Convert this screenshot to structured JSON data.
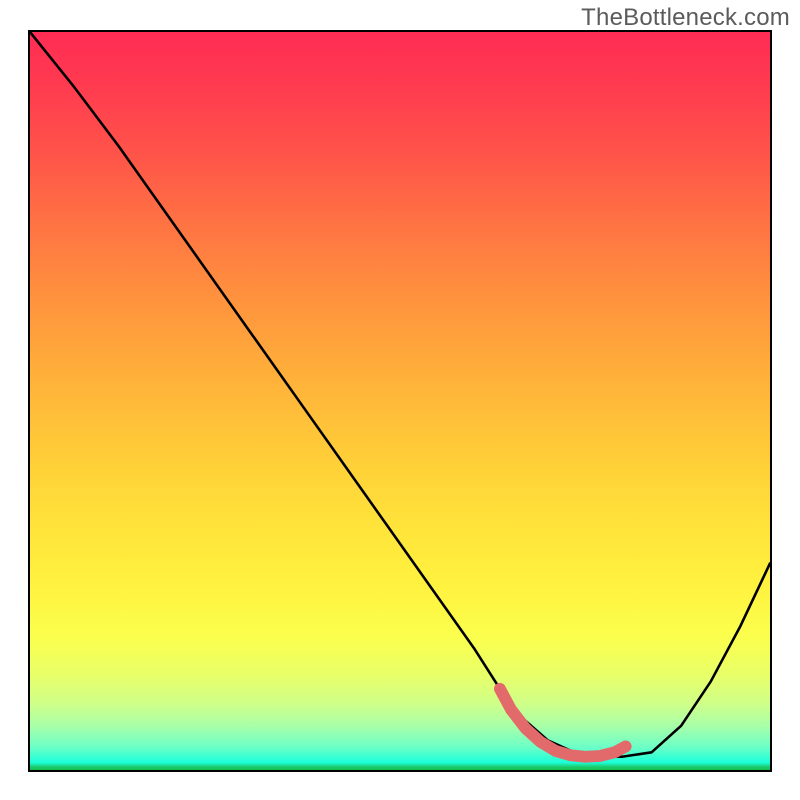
{
  "watermark": "TheBottleneck.com",
  "chart_data": {
    "type": "line",
    "title": "",
    "xlabel": "",
    "ylabel": "",
    "xlim": [
      0,
      100
    ],
    "ylim": [
      0,
      100
    ],
    "series": [
      {
        "name": "bottleneck-curve",
        "style": "thin-black",
        "x": [
          0,
          6,
          12,
          18,
          24,
          30,
          36,
          42,
          48,
          54,
          60,
          63.5,
          66,
          70,
          74,
          77.5,
          80,
          84,
          88,
          92,
          96,
          100
        ],
        "y": [
          100,
          92.5,
          84.5,
          76,
          67.5,
          59,
          50.5,
          42,
          33.5,
          25,
          16.5,
          11,
          7.5,
          4,
          2.2,
          1.8,
          1.8,
          2.4,
          6,
          12,
          19.5,
          28
        ]
      },
      {
        "name": "optimal-band",
        "style": "thick-salmon",
        "x": [
          63.5,
          65,
          67,
          69,
          71,
          73,
          75,
          77,
          79,
          80.5
        ],
        "y": [
          11,
          8.2,
          5.6,
          3.8,
          2.6,
          2.0,
          1.8,
          1.9,
          2.4,
          3.2
        ]
      }
    ],
    "gradient_background": {
      "top_color": "#ff2c54",
      "mid_color": "#ffe33a",
      "bottom_color": "#12c24e",
      "meaning": "red=high bottleneck, green=low bottleneck"
    }
  }
}
